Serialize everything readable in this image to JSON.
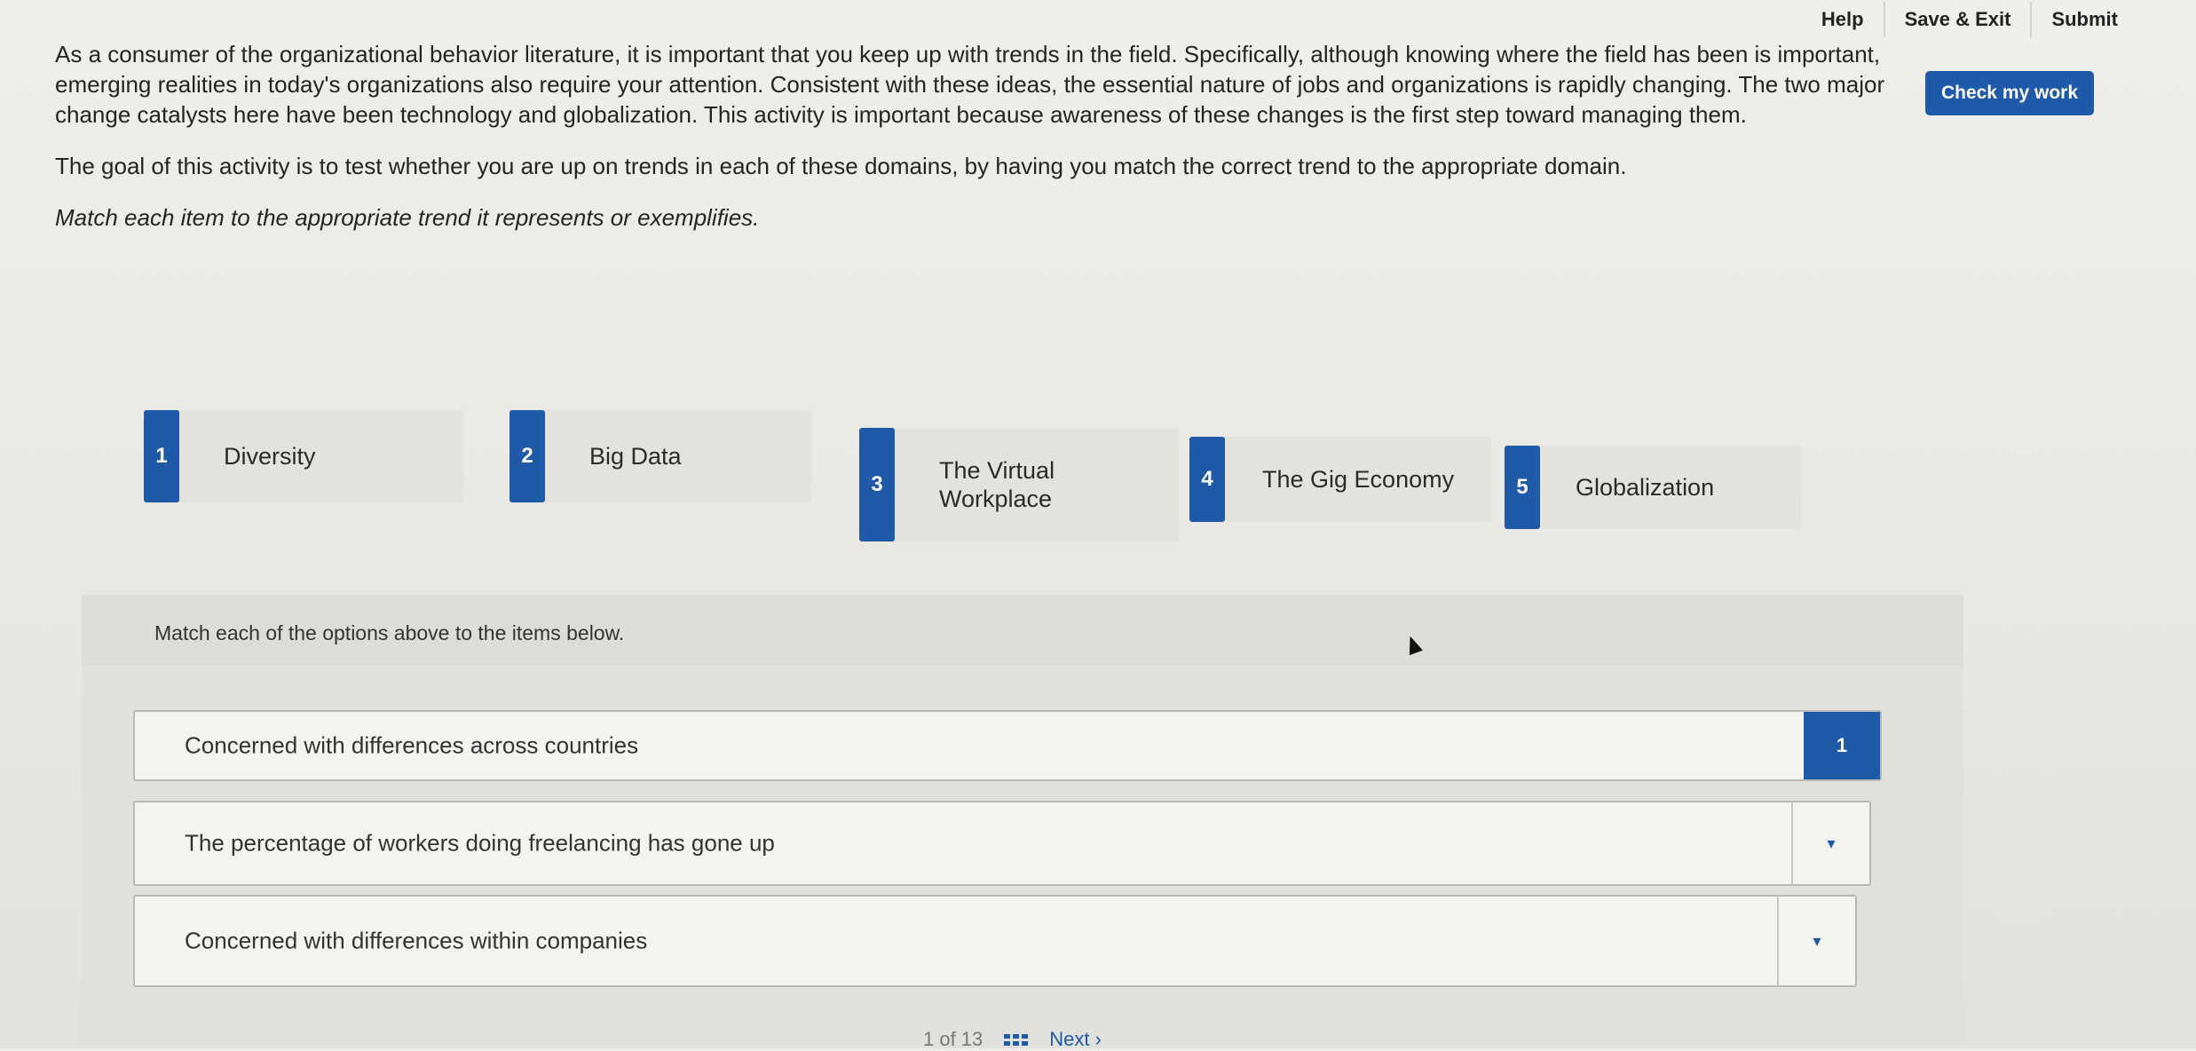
{
  "topnav": {
    "help": "Help",
    "save_exit": "Save & Exit",
    "submit": "Submit"
  },
  "check_button": "Check my work",
  "intro": {
    "p1": "As a consumer of the organizational behavior literature, it is important that you keep up with trends in the field. Specifically, although knowing where the field has been is important, emerging realities in today's organizations also require your attention. Consistent with these ideas, the essential nature of jobs and organizations is rapidly changing. The two major change catalysts here have been technology and globalization. This activity is important because awareness of these changes is the first step toward managing them.",
    "p2": "The goal of this activity is to test whether you are up on trends in each of these domains, by having you match the correct trend to the appropriate domain.",
    "instruction": "Match each item to the appropriate trend it represents or exemplifies."
  },
  "options": [
    {
      "num": "1",
      "label": "Diversity"
    },
    {
      "num": "2",
      "label": "Big Data"
    },
    {
      "num": "3",
      "label": "The Virtual Workplace"
    },
    {
      "num": "4",
      "label": "The Gig Economy"
    },
    {
      "num": "5",
      "label": "Globalization"
    }
  ],
  "match_header": "Match each of the options above to the items below.",
  "items": [
    {
      "text": "Concerned with differences across countries",
      "selected": "1"
    },
    {
      "text": "The percentage of workers doing freelancing has gone up",
      "selected": "▾"
    },
    {
      "text": "Concerned with differences within companies",
      "selected": "▾"
    }
  ],
  "pager": {
    "position": "1 of 13",
    "next": "Next  ›"
  },
  "colors": {
    "accent": "#1f5aa8"
  }
}
